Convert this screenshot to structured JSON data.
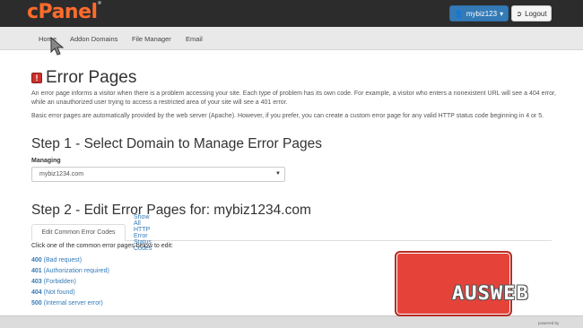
{
  "header": {
    "logo": "cPanel",
    "logo_mark": "®",
    "user_label": "mybiz123",
    "logout_label": "Logout",
    "accent_color": "#337ab7",
    "brand_color": "#ff6c2c"
  },
  "nav": {
    "items": [
      {
        "label": "Home"
      },
      {
        "label": "Addon Domains"
      },
      {
        "label": "File Manager"
      },
      {
        "label": "Email"
      }
    ]
  },
  "page": {
    "title": "Error Pages",
    "intro_1": "An error page informs a visitor when there is a problem accessing your site. Each type of problem has its own code. For example, a visitor who enters a nonexistent URL will see a 404 error, while an unauthorized user trying to access a restricted area of your site will see a 401 error.",
    "intro_2": "Basic error pages are automatically provided by the web server (Apache). However, if you prefer, you can create a custom error page for any valid HTTP status code beginning in 4 or 5."
  },
  "step1": {
    "heading": "Step 1 - Select Domain to Manage Error Pages",
    "managing_label": "Managing",
    "selected_domain": "mybiz1234.com"
  },
  "step2": {
    "heading": "Step 2 - Edit Error Pages for: mybiz1234.com",
    "tab_common": "Edit Common Error Codes",
    "tab_all": "Show All HTTP Error Status Codes",
    "hint": "Click one of the common error pages below to edit:",
    "errors": [
      {
        "code": "400",
        "desc": "(Bad request)"
      },
      {
        "code": "401",
        "desc": "(Authorization required)"
      },
      {
        "code": "403",
        "desc": "(Forbidden)"
      },
      {
        "code": "404",
        "desc": "(Not found)"
      },
      {
        "code": "500",
        "desc": "(Internal server error)"
      }
    ]
  },
  "watermark": {
    "text": "AUSWEB",
    "powered": "powered by"
  }
}
